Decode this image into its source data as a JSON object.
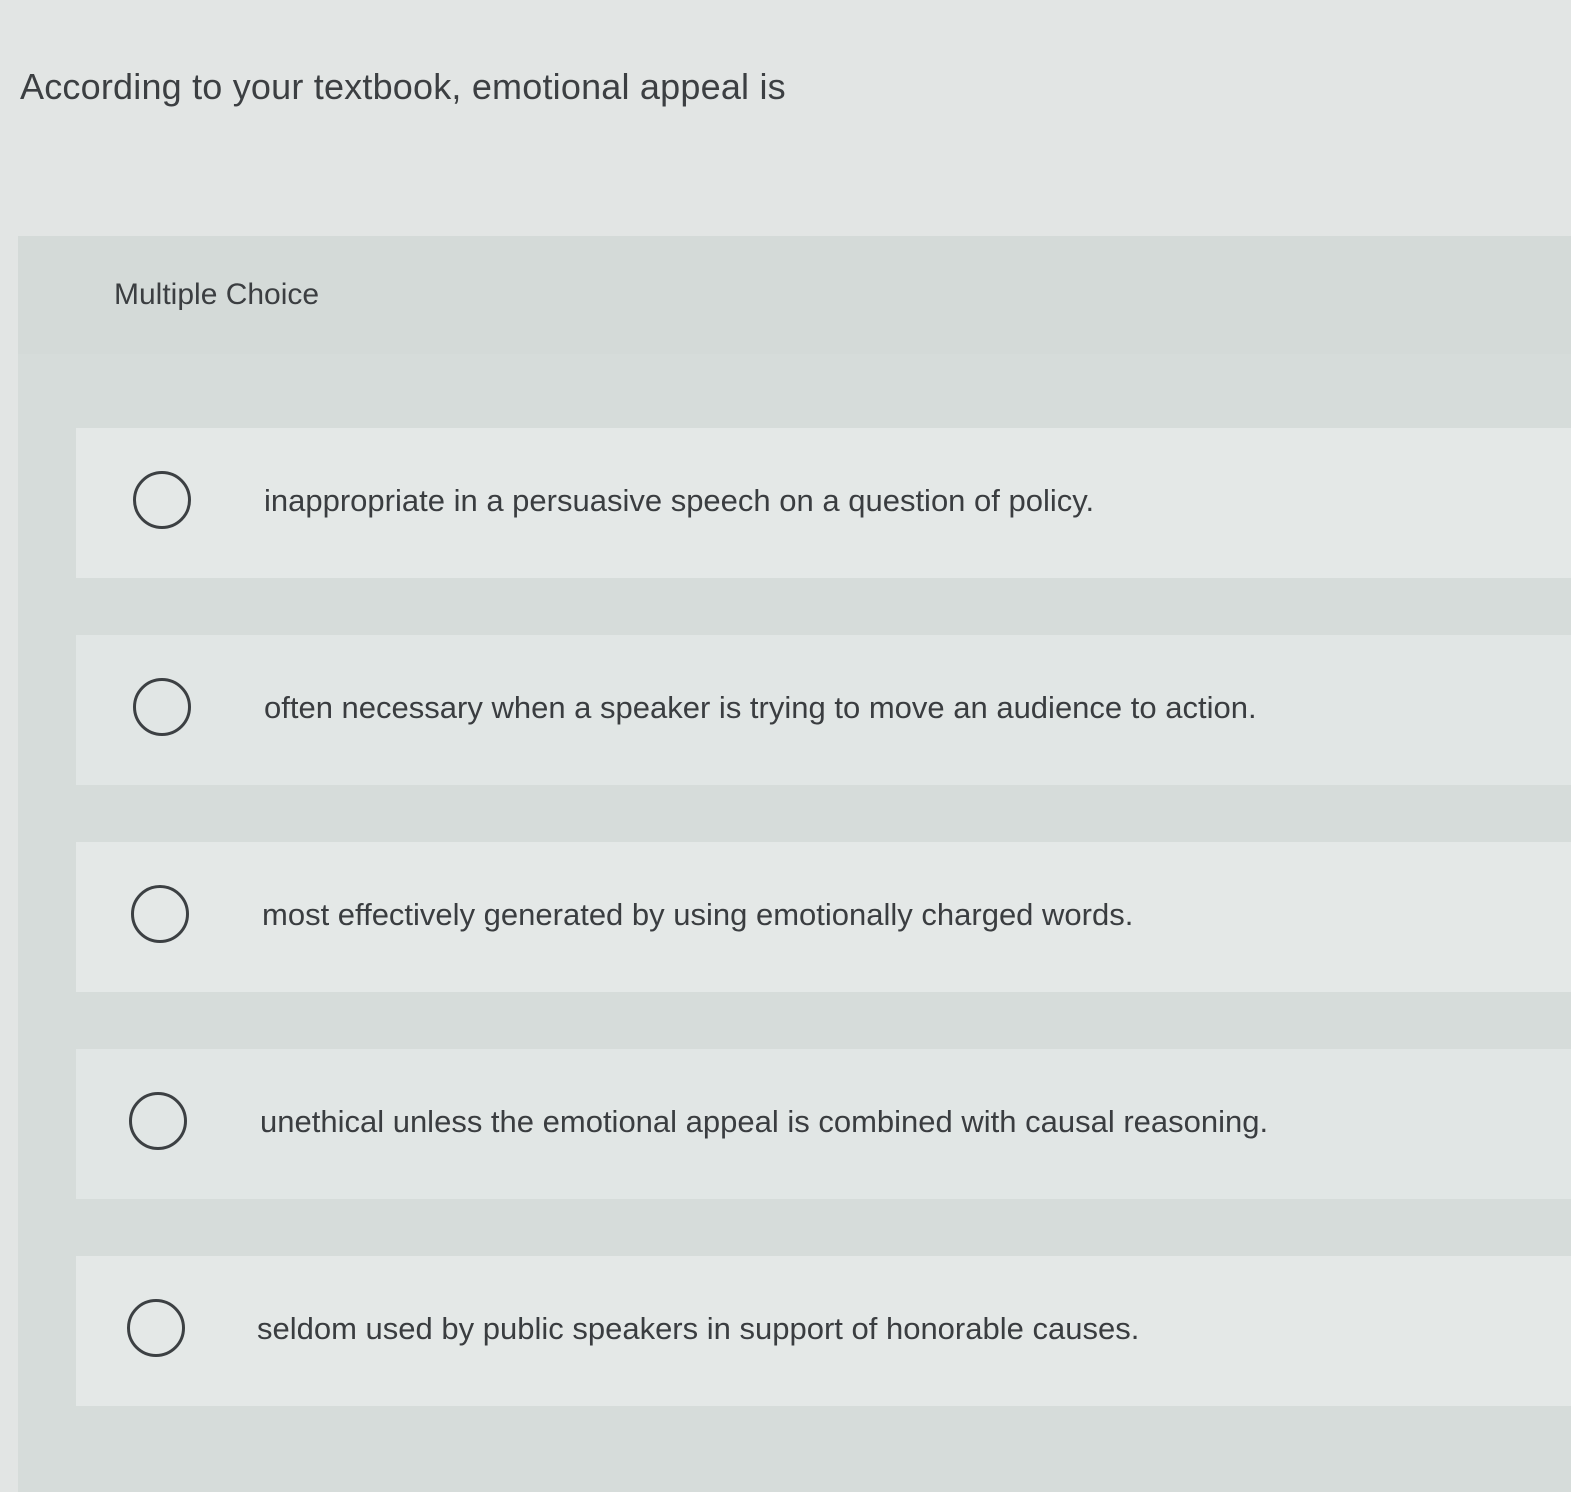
{
  "question": {
    "prompt": "According to your textbook, emotional appeal is"
  },
  "panel": {
    "type_label": "Multiple Choice"
  },
  "options": [
    {
      "text": "inappropriate in a persuasive speech on a question of policy.",
      "selected": false
    },
    {
      "text": "often necessary when a speaker is trying to move an audience to action.",
      "selected": false
    },
    {
      "text": "most effectively generated by using emotionally charged words.",
      "selected": false
    },
    {
      "text": "unethical unless the emotional appeal is combined with causal reasoning.",
      "selected": false
    },
    {
      "text": "seldom used by public speakers in support of honorable causes.",
      "selected": false
    }
  ]
}
